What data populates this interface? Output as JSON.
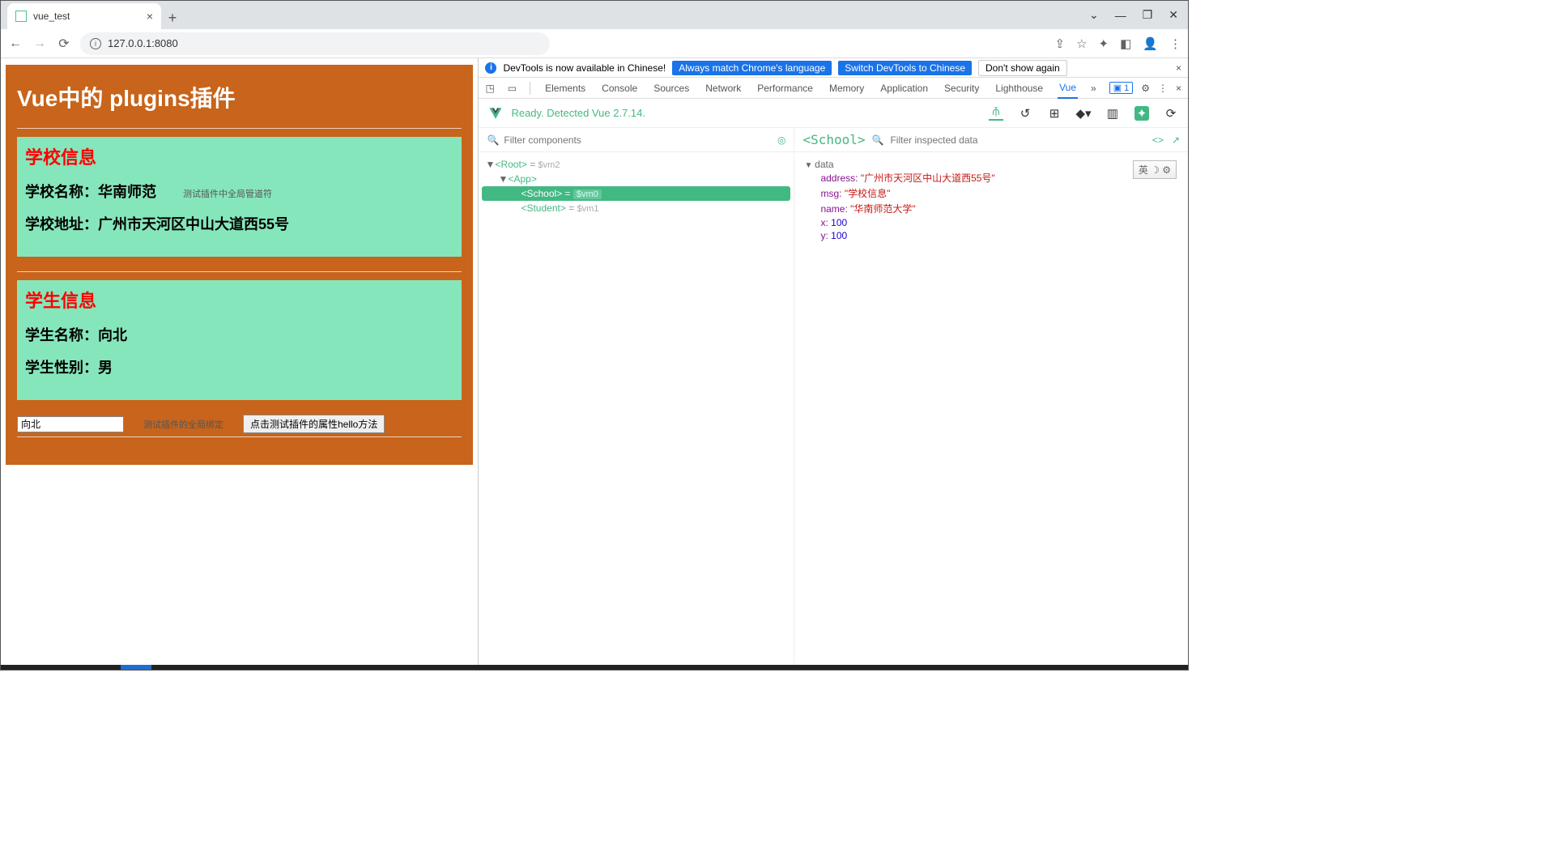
{
  "browser": {
    "tab_title": "vue_test",
    "url": "127.0.0.1:8080",
    "window_controls": {
      "chevron": "⌄",
      "min": "—",
      "max": "❐",
      "close": "✕"
    }
  },
  "app": {
    "title": "Vue中的 plugins插件",
    "school": {
      "heading": "学校信息",
      "name_label": "学校名称：华南师范",
      "name_note": "测试插件中全局管道符",
      "address_label": "学校地址：广州市天河区中山大道西55号"
    },
    "student": {
      "heading": "学生信息",
      "name_label": "学生名称：向北",
      "gender_label": "学生性别：男"
    },
    "footer": {
      "input_value": "向北",
      "note": "测试插件的全局绑定",
      "button": "点击测试插件的属性hello方法"
    }
  },
  "devtools": {
    "banner": {
      "text": "DevTools is now available in Chinese!",
      "btn1": "Always match Chrome's language",
      "btn2": "Switch DevTools to Chinese",
      "btn3": "Don't show again"
    },
    "tabs": [
      "Elements",
      "Console",
      "Sources",
      "Network",
      "Performance",
      "Memory",
      "Application",
      "Security",
      "Lighthouse",
      "Vue"
    ],
    "issues_count": "1",
    "vue_status": "Ready. Detected Vue 2.7.14.",
    "tree_search_placeholder": "Filter components",
    "tree": {
      "root": "Root",
      "root_vm": "$vm2",
      "app": "App",
      "school": "School",
      "school_vm": "$vm0",
      "student": "Student",
      "student_vm": "$vm1"
    },
    "inspect": {
      "component": "<School>",
      "search_placeholder": "Filter inspected data",
      "section": "data",
      "rows": {
        "address_k": "address:",
        "address_v": "\"广州市天河区中山大道西55号\"",
        "msg_k": "msg:",
        "msg_v": "\"学校信息\"",
        "name_k": "name:",
        "name_v": "\"华南师范大学\"",
        "x_k": "x:",
        "x_v": "100",
        "y_k": "y:",
        "y_v": "100"
      }
    },
    "ime": "英 ☽ ⚙"
  }
}
